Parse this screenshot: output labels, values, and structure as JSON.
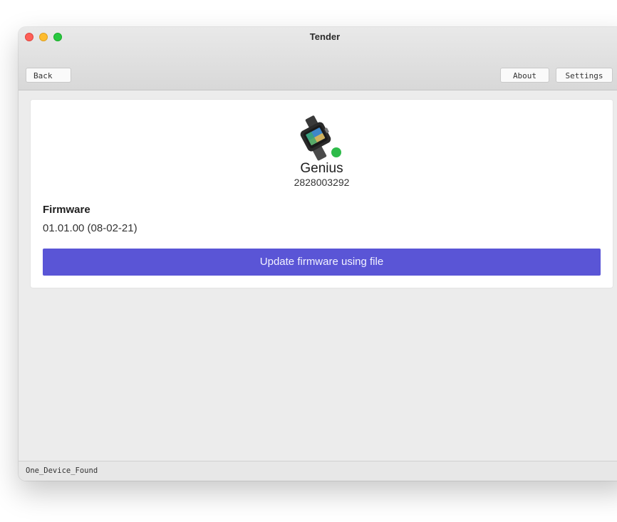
{
  "window": {
    "title": "Tender"
  },
  "toolbar": {
    "back_label": "Back",
    "about_label": "About",
    "settings_label": "Settings"
  },
  "device": {
    "name": "Genius",
    "serial": "2828003292",
    "status_color": "#2ebb4a",
    "icon": "smartwatch-device-icon"
  },
  "firmware": {
    "heading": "Firmware",
    "version": "01.01.00 (08-02-21)",
    "update_label": "Update firmware using file",
    "accent_color": "#5a55d6"
  },
  "statusbar": {
    "text": "One_Device_Found"
  }
}
